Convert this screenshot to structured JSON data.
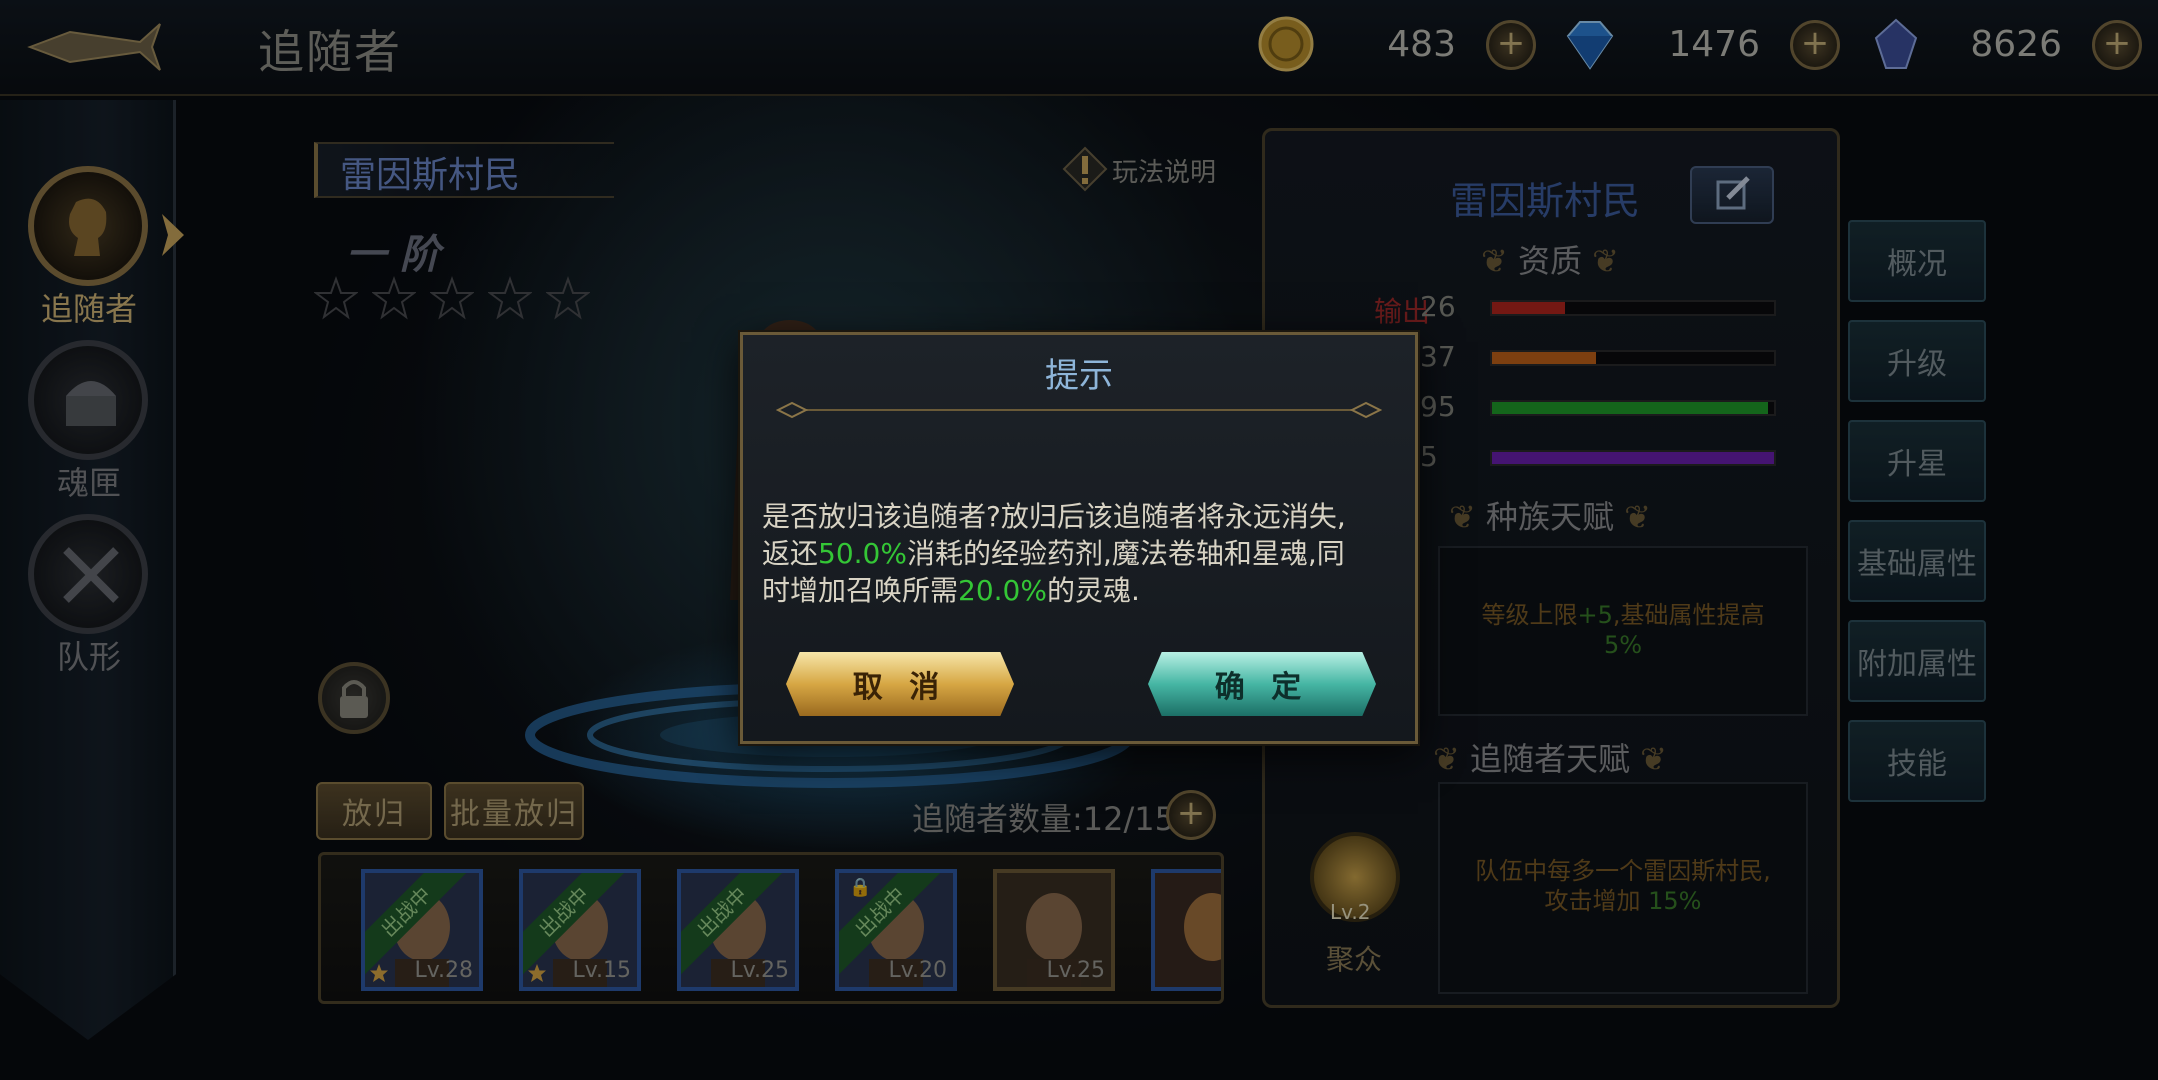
{
  "header": {
    "title": "追随者",
    "resources": [
      {
        "name": "gold",
        "value": "483"
      },
      {
        "name": "diamond",
        "value": "1476"
      },
      {
        "name": "soul-crystal",
        "value": "8626"
      }
    ]
  },
  "sidebar": {
    "items": [
      {
        "label": "追随者",
        "active": true
      },
      {
        "label": "魂匣",
        "active": false
      },
      {
        "label": "队形",
        "active": false
      }
    ]
  },
  "center": {
    "follower_name": "雷因斯村民",
    "help_label": "玩法说明",
    "rank": "一 阶",
    "stars_filled": 0,
    "stars_total": 5,
    "release_label": "放归",
    "batch_release_label": "批量放归",
    "count_label": "追随者数量:12/15",
    "roster": [
      {
        "status": "出战中",
        "level": "Lv.28",
        "star": true,
        "locked": false
      },
      {
        "status": "出战中",
        "level": "Lv.15",
        "star": true,
        "locked": false
      },
      {
        "status": "出战中",
        "level": "Lv.25",
        "star": false,
        "locked": false
      },
      {
        "status": "出战中",
        "level": "Lv.20",
        "star": false,
        "locked": true
      },
      {
        "status": "",
        "level": "Lv.25",
        "star": false,
        "locked": false
      }
    ]
  },
  "right_panel": {
    "name": "雷因斯村民",
    "aptitude_title": "资质",
    "stats": [
      {
        "label": "输出",
        "value": "26",
        "fill": 0.26,
        "color": "#b3261e"
      },
      {
        "label": "",
        "value": "37",
        "fill": 0.37,
        "color": "#c0621a"
      },
      {
        "label": "",
        "value": "95",
        "fill": 0.98,
        "color": "#1f9b2a"
      },
      {
        "label": "",
        "value": "5",
        "fill": 1.0,
        "color": "#6a1fb0"
      }
    ],
    "race_talent_title": "种族天赋",
    "race_talent": {
      "pre": "等级上限",
      "num1": "+5",
      "mid": ",基础属性提高",
      "num2": "5%"
    },
    "follower_talent_title": "追随者天赋",
    "follower_talent": {
      "line1": "队伍中每多一个雷因斯村民,",
      "line2_pre": "攻击增加 ",
      "num": "15%"
    },
    "talent_medal": {
      "level": "Lv.2",
      "name": "聚众"
    }
  },
  "tabs": [
    "概况",
    "升级",
    "升星",
    "基础属性",
    "附加属性",
    "技能"
  ],
  "modal": {
    "title": "提示",
    "msg_1": "是否放归该追随者?放归后该追随者将永远消失,",
    "msg_2_pre": "返还",
    "msg_2_num": "50.0%",
    "msg_2_post": "消耗的经验药剂,魔法卷轴和星魂,同",
    "msg_3_pre": "时增加召唤所需",
    "msg_3_num": "20.0%",
    "msg_3_post": "的灵魂.",
    "cancel_label": "取 消",
    "confirm_label": "确 定"
  },
  "colors": {
    "highlight_green": "#34c636",
    "gold_accent": "#8b7548",
    "title_blue": "#8eb5d9"
  }
}
